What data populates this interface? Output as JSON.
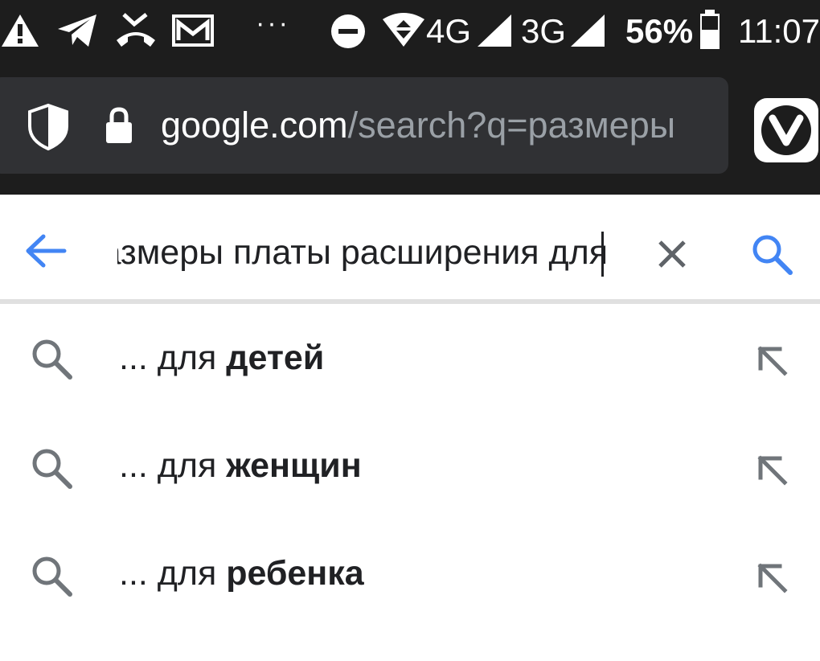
{
  "status_bar": {
    "network_4g": "4G",
    "network_3g": "3G",
    "battery": "56%",
    "time": "11:07",
    "more_notifications": "···",
    "icons": [
      "warning-icon",
      "telegram-icon",
      "missed-call-icon",
      "mail-icon",
      "do-not-disturb-icon",
      "wifi-icon",
      "signal-icon",
      "battery-icon"
    ]
  },
  "browser": {
    "url_host": "google.com",
    "url_path": "/search?q=размеры",
    "icons": [
      "shield-icon",
      "lock-icon",
      "vivaldi-icon"
    ]
  },
  "search": {
    "query": "размеры платы расширения для",
    "icons": [
      "back-arrow-icon",
      "clear-icon",
      "search-icon"
    ]
  },
  "suggestions": [
    {
      "prefix": "... для ",
      "completion": "детей"
    },
    {
      "prefix": "... для ",
      "completion": "женщин"
    },
    {
      "prefix": "... для ",
      "completion": "ребенка"
    }
  ],
  "colors": {
    "accent": "#4285f4",
    "dark_bar": "#1d1d1d",
    "url_box": "#303134",
    "icon_gray": "#70757a"
  }
}
